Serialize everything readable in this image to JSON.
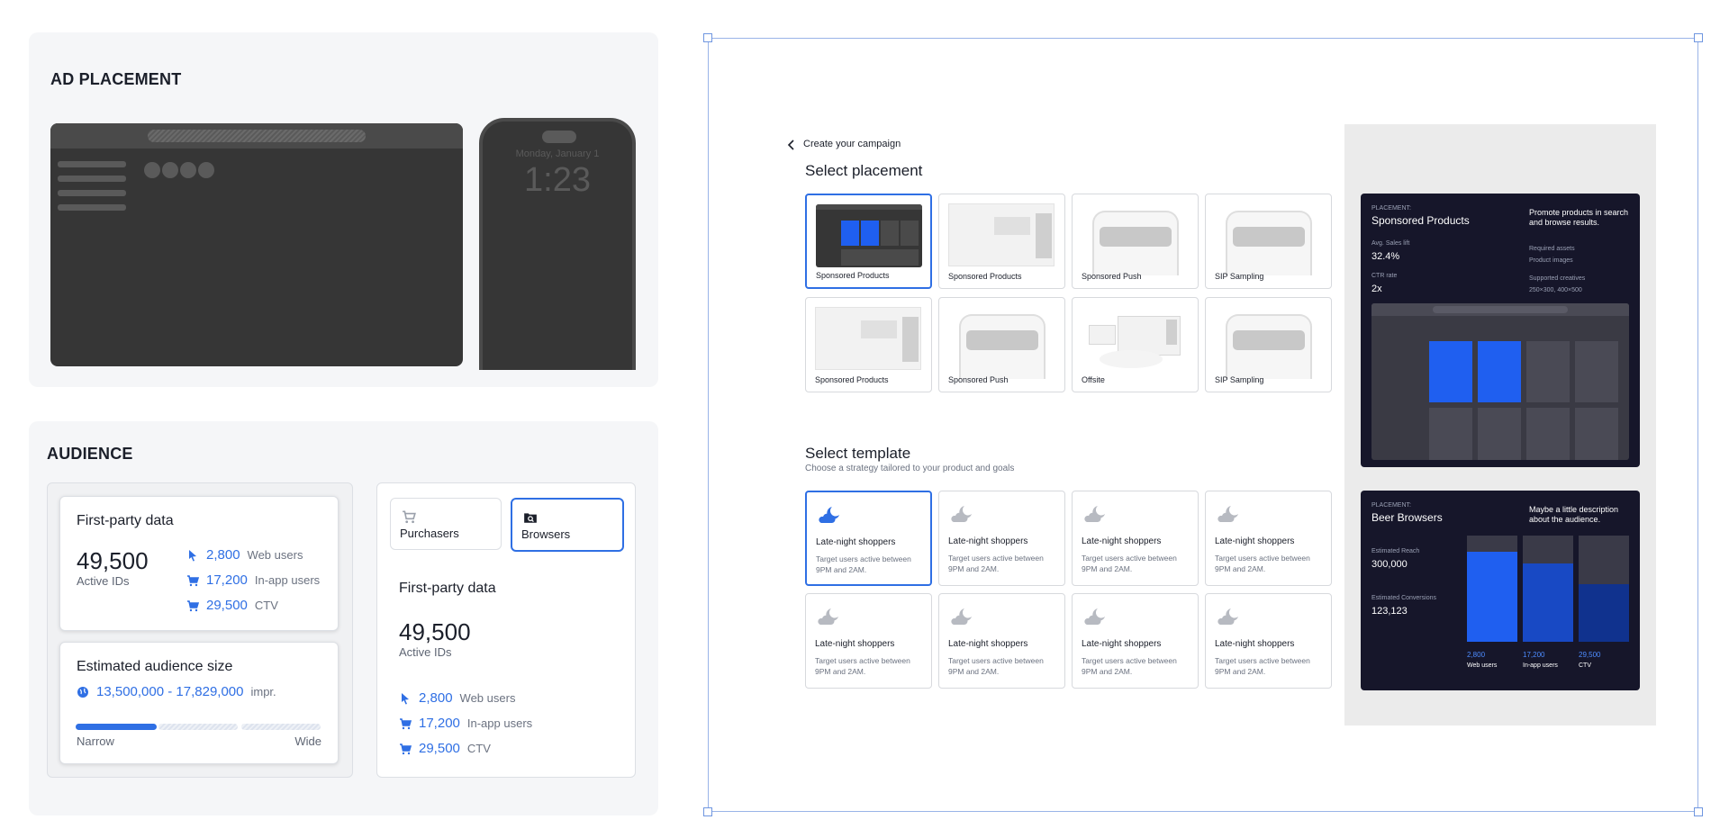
{
  "ad_placement": {
    "title": "AD PLACEMENT",
    "phone_date": "Monday, January 1",
    "phone_time": "1:23"
  },
  "audience": {
    "title": "AUDIENCE",
    "first_party": {
      "title": "First-party data",
      "count": "49,500",
      "count_label": "Active IDs",
      "stats": [
        {
          "icon": "cursor-icon",
          "value": "2,800",
          "label": "Web users"
        },
        {
          "icon": "cart-icon",
          "value": "17,200",
          "label": "In-app users"
        },
        {
          "icon": "cart-icon",
          "value": "29,500",
          "label": "CTV"
        }
      ]
    },
    "estimated": {
      "title": "Estimated audience size",
      "range": "13,500,000 - 17,829,000",
      "unit": "impr.",
      "low_label": "Narrow",
      "high_label": "Wide",
      "level": 0.33
    },
    "tabs": [
      {
        "label": "Purchasers",
        "icon": "cart-icon",
        "selected": false
      },
      {
        "label": "Browsers",
        "icon": "folder-search-icon",
        "selected": true
      }
    ],
    "detail": {
      "title": "First-party data",
      "count": "49,500",
      "count_label": "Active IDs",
      "stats": [
        {
          "icon": "cursor-icon",
          "value": "2,800",
          "label": "Web users"
        },
        {
          "icon": "cart-icon",
          "value": "17,200",
          "label": "In-app users"
        },
        {
          "icon": "cart-icon",
          "value": "29,500",
          "label": "CTV"
        }
      ]
    }
  },
  "campaign": {
    "back_label": "Create your campaign",
    "placement_heading": "Select placement",
    "placements": [
      {
        "label": "Sponsored Products",
        "kind": "browser-dark",
        "selected": true
      },
      {
        "label": "Sponsored Products",
        "kind": "browser-light",
        "selected": false
      },
      {
        "label": "Sponsored Push",
        "kind": "phone",
        "selected": false
      },
      {
        "label": "SIP Sampling",
        "kind": "phone",
        "selected": false
      },
      {
        "label": "Sponsored Products",
        "kind": "browser-light",
        "selected": false
      },
      {
        "label": "Sponsored Push",
        "kind": "phone",
        "selected": false
      },
      {
        "label": "Offsite",
        "kind": "offsite",
        "selected": false
      },
      {
        "label": "SIP Sampling",
        "kind": "phone",
        "selected": false
      }
    ],
    "template_heading": "Select template",
    "template_sub": "Choose a strategy tailored to your product and goals",
    "templates": [
      {
        "title": "Late-night shoppers",
        "desc": "Target users active between 9PM and 2AM.",
        "selected": true
      },
      {
        "title": "Late-night shoppers",
        "desc": "Target users active between 9PM and 2AM.",
        "selected": false
      },
      {
        "title": "Late-night shoppers",
        "desc": "Target users active between 9PM and 2AM.",
        "selected": false
      },
      {
        "title": "Late-night shoppers",
        "desc": "Target users active between 9PM and 2AM.",
        "selected": false
      },
      {
        "title": "Late-night shoppers",
        "desc": "Target users active between 9PM and 2AM.",
        "selected": false
      },
      {
        "title": "Late-night shoppers",
        "desc": "Target users active between 9PM and 2AM.",
        "selected": false
      },
      {
        "title": "Late-night shoppers",
        "desc": "Target users active between 9PM and 2AM.",
        "selected": false
      },
      {
        "title": "Late-night shoppers",
        "desc": "Target users active between 9PM and 2AM.",
        "selected": false
      }
    ],
    "placement_preview": {
      "kicker": "PLACEMENT:",
      "name": "Sponsored Products",
      "desc": "Promote products in search and browse results.",
      "metrics": [
        {
          "label": "Avg. Sales lift",
          "value": "32.4%"
        },
        {
          "label": "CTR rate",
          "value": "2x"
        }
      ],
      "assets_label": "Required assets",
      "assets_value": "Product images",
      "creatives_label": "Supported creatives",
      "creatives_value": "250×300, 400×500"
    },
    "audience_preview": {
      "kicker": "PLACEMENT:",
      "name": "Beer Browsers",
      "desc": "Maybe a little description about the audience.",
      "reach_label": "Estimated Reach",
      "reach_value": "300,000",
      "conv_label": "Estimated Conversions",
      "conv_value": "123,123",
      "bars": [
        {
          "value": "2,800",
          "label": "Web users",
          "icon": "cursor-icon",
          "fill": 0.85,
          "color": "#1f5ff0"
        },
        {
          "value": "17,200",
          "label": "In-app users",
          "icon": "grid-icon",
          "fill": 0.74,
          "color": "#1849c4"
        },
        {
          "value": "29,500",
          "label": "CTV",
          "icon": "tv-icon",
          "fill": 0.54,
          "color": "#10328e"
        }
      ]
    }
  },
  "colors": {
    "accent": "#2f6fe4",
    "dark_card": "#16162a",
    "selection": "#9ab4e8"
  }
}
